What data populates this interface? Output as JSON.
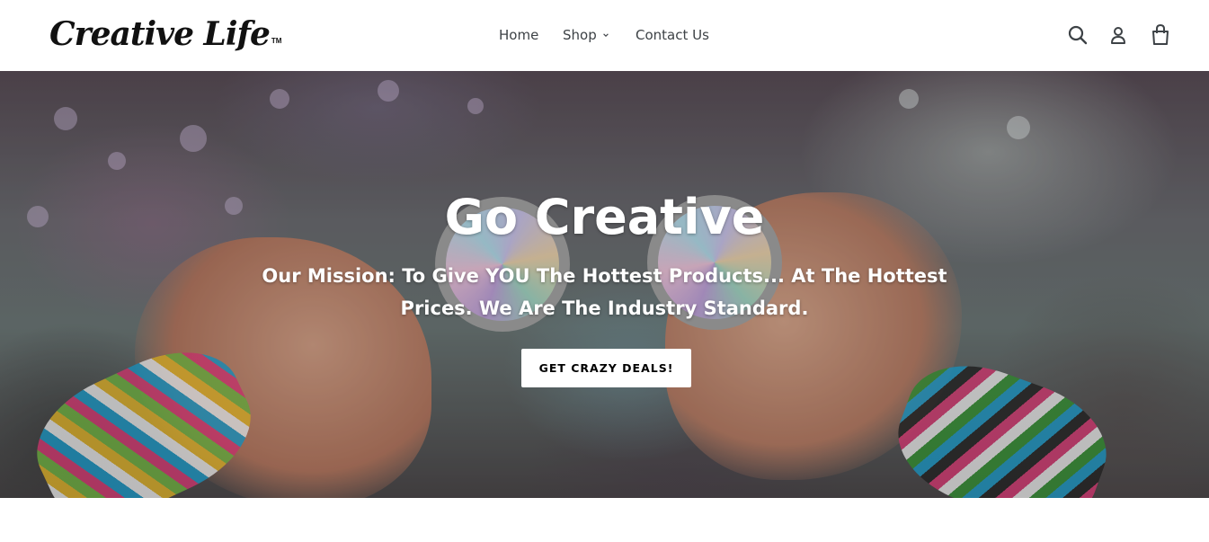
{
  "header": {
    "logo_text": "Creative Life",
    "logo_tm": "TM",
    "nav": {
      "home": "Home",
      "shop": "Shop",
      "contact": "Contact Us"
    },
    "icons": {
      "search": "search-icon",
      "account": "user-icon",
      "cart": "cart-icon"
    }
  },
  "hero": {
    "title": "Go Creative",
    "subtitle": "Our Mission: To Give YOU The Hottest Products... At The Hottest Prices. We Are The Industry Standard.",
    "cta_label": "GET CRAZY DEALS!"
  },
  "colors": {
    "nav_text": "#3d4246",
    "hero_text": "#ffffff",
    "cta_bg": "#ffffff",
    "cta_text": "#000000"
  }
}
